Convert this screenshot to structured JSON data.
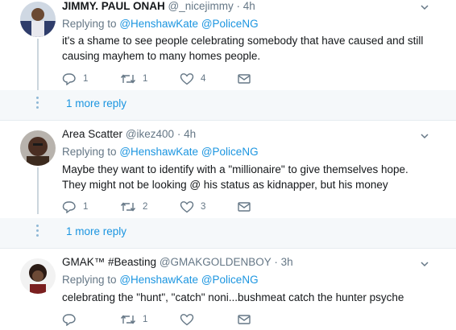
{
  "tweets": [
    {
      "name": "JIMMY. PAUL ONAH",
      "handle": "@_nicejimmy",
      "dot": "·",
      "time": "4h",
      "replying_prefix": "Replying to",
      "replying_to_1": "@HenshawKate",
      "replying_to_2": "@PoliceNG",
      "text": "it's a shame to see people celebrating somebody that have caused and still causing mayhem to many homes people.",
      "replies": "1",
      "retweets": "1",
      "likes": "4",
      "more_replies": "1 more reply"
    },
    {
      "name": "Area Scatter",
      "handle": "@ikez400",
      "dot": "·",
      "time": "4h",
      "replying_prefix": "Replying to",
      "replying_to_1": "@HenshawKate",
      "replying_to_2": "@PoliceNG",
      "text": "Maybe they want to identify with a \"millionaire\" to give themselves hope. They might not be looking @ his status as kidnapper, but his money",
      "replies": "1",
      "retweets": "2",
      "likes": "3",
      "more_replies": "1 more reply"
    },
    {
      "name": "GMAK™ #Beasting",
      "handle": "@GMAKGOLDENBOY",
      "dot": "·",
      "time": "3h",
      "replying_prefix": "Replying to",
      "replying_to_1": "@HenshawKate",
      "replying_to_2": "@PoliceNG",
      "text": "celebrating the \"hunt\", \"catch\" noni...bushmeat catch the hunter psyche",
      "replies": "",
      "retweets": "1",
      "likes": "",
      "more_replies": ""
    }
  ],
  "icons": {
    "reply": "reply-icon",
    "retweet": "retweet-icon",
    "like": "heart-icon",
    "message": "envelope-icon",
    "menu": "chevron-down-icon"
  },
  "colors": {
    "link": "#1b95e0",
    "muted": "#657786",
    "thread_line": "#ccd6dd",
    "panel": "#f5f8fa"
  }
}
